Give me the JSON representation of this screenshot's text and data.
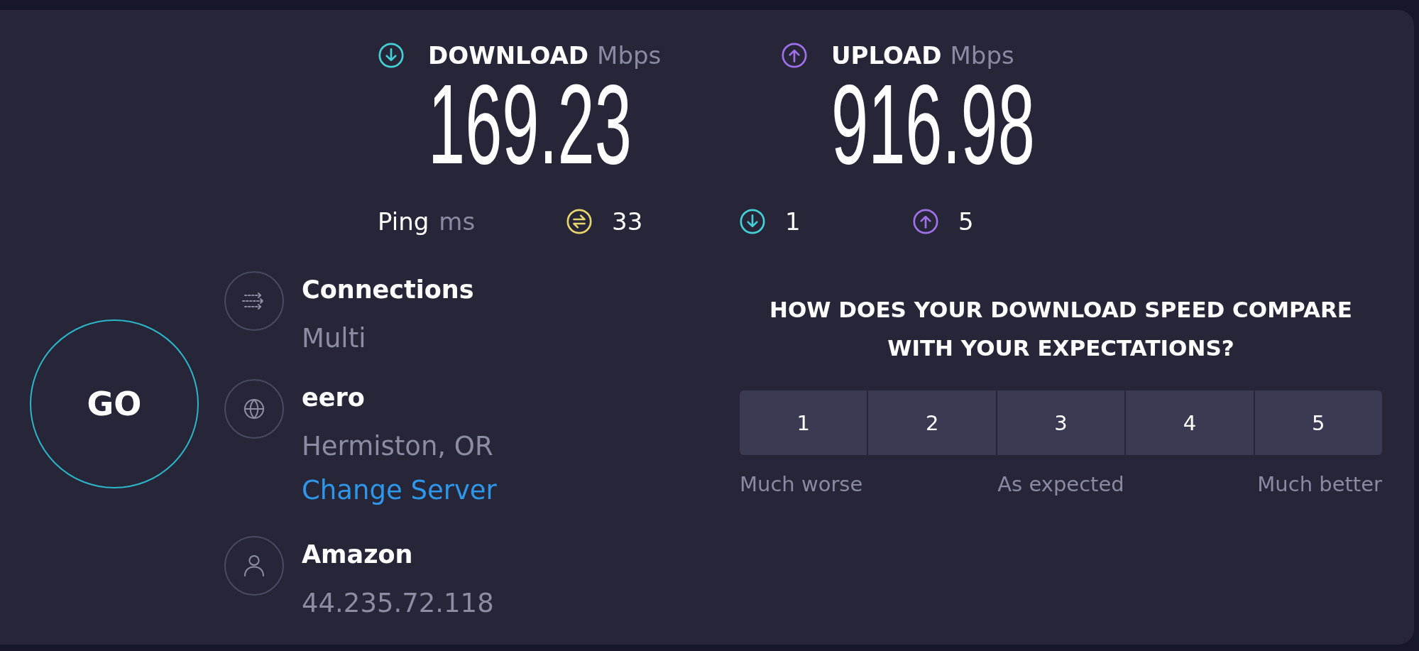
{
  "speeds": [
    {
      "kind": "download",
      "label": "DOWNLOAD",
      "unit": "Mbps",
      "value": "169.23"
    },
    {
      "kind": "upload",
      "label": "UPLOAD",
      "unit": "Mbps",
      "value": "916.98"
    }
  ],
  "ping": {
    "label": "Ping",
    "unit": "ms",
    "readings": [
      {
        "kind": "idle",
        "value": "33"
      },
      {
        "kind": "download",
        "value": "1"
      },
      {
        "kind": "upload",
        "value": "5"
      }
    ]
  },
  "go_button": {
    "label": "GO"
  },
  "details": [
    {
      "kind": "connections",
      "title": "Connections",
      "subtitle": "Multi"
    },
    {
      "kind": "server",
      "title": "eero",
      "subtitle": "Hermiston, OR",
      "link": "Change Server"
    },
    {
      "kind": "provider",
      "title": "Amazon",
      "subtitle": "44.235.72.118"
    }
  ],
  "survey": {
    "question": "HOW DOES YOUR DOWNLOAD SPEED COMPARE WITH YOUR EXPECTATIONS?",
    "options": [
      {
        "label": "1",
        "selected": false
      },
      {
        "label": "2",
        "selected": false
      },
      {
        "label": "3",
        "selected": false
      },
      {
        "label": "4",
        "selected": false
      },
      {
        "label": "5",
        "selected": false
      }
    ],
    "scale_labels": [
      "Much worse",
      "As expected",
      "Much better"
    ]
  }
}
